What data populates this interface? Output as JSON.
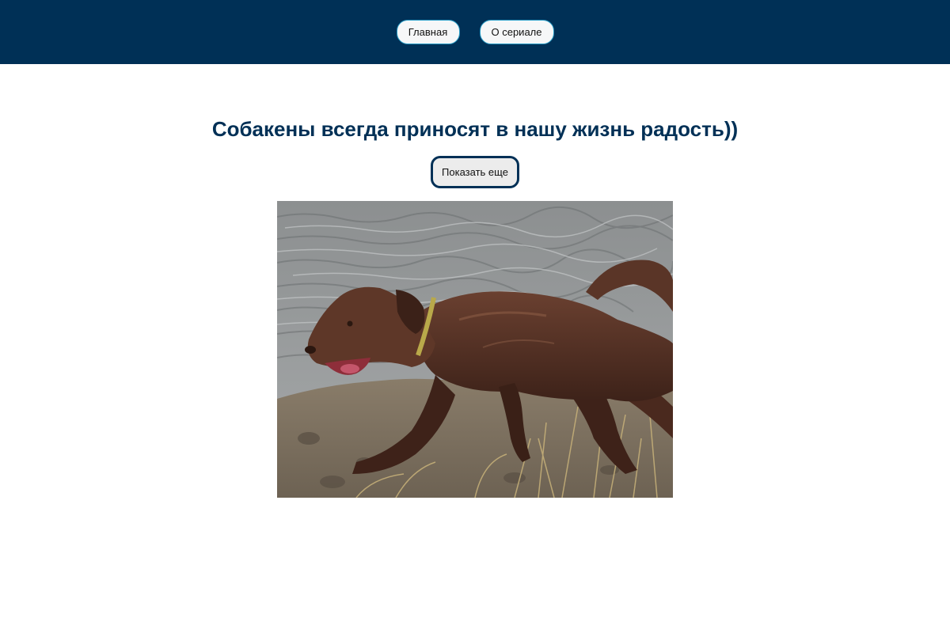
{
  "nav": {
    "home_label": "Главная",
    "about_label": "О сериале"
  },
  "main": {
    "title": "Собакены всегда приносят в нашу жизнь радость))",
    "show_more_label": "Показать еще"
  },
  "photo": {
    "subject": "brown-dog-by-water"
  },
  "colors": {
    "header_bg": "#003056",
    "title": "#003056",
    "nav_border": "#2a9fc9"
  }
}
